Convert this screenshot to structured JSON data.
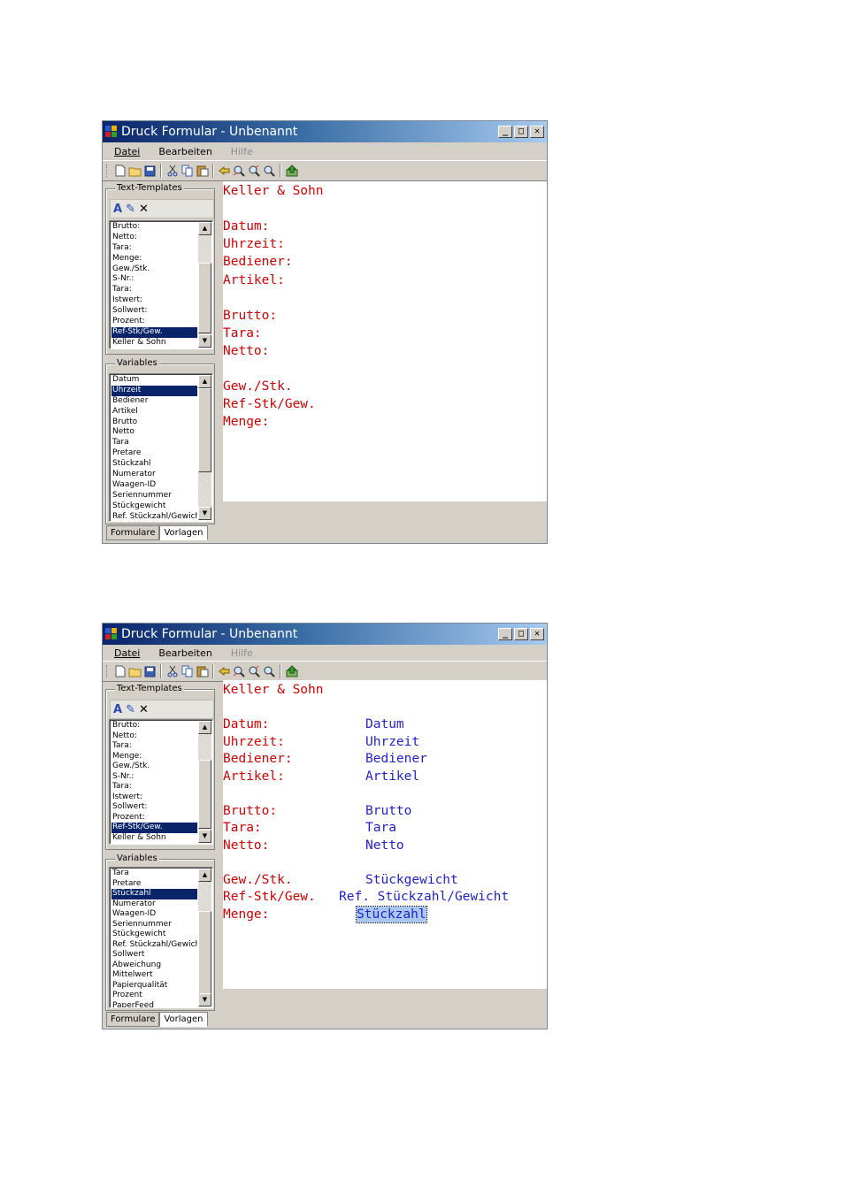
{
  "window_title": "Druck Formular - Unbenannt",
  "window_controls": {
    "minimize": "_",
    "maximize": "□",
    "close": "✕"
  },
  "menu": [
    {
      "label": "Datei",
      "disabled": false
    },
    {
      "label": "Bearbeiten",
      "disabled": false
    },
    {
      "label": "Hilfe",
      "disabled": true
    }
  ],
  "toolbar_icons": [
    "new-file-icon",
    "open-folder-icon",
    "save-icon",
    "cut-icon",
    "copy-icon",
    "paste-icon",
    "left-bracket-icon",
    "zoom-out-icon",
    "zoom-in-icon",
    "zoom-icon",
    "export-icon"
  ],
  "text_templates_label": "Text-Templates",
  "variables_label": "Variables",
  "tabs": {
    "formulare": "Formulare",
    "vorlagen": "Vorlagen"
  },
  "text_templates": [
    "Brutto:",
    "Netto:",
    "Tara:",
    "Menge:",
    "Gew./Stk.",
    "S-Nr.:",
    "Tara:",
    "Istwert:",
    "Sollwert:",
    "Prozent:",
    "Ref-Stk/Gew.",
    "Keller & Sohn"
  ],
  "text_templates_selected": "Ref-Stk/Gew.",
  "screen1": {
    "variables": [
      "Datum",
      "Uhrzeit",
      "Bediener",
      "Artikel",
      "Brutto",
      "Netto",
      "Tara",
      "Pretare",
      "Stückzahl",
      "Numerator",
      "Waagen-ID",
      "Seriennummer",
      "Stückgewicht",
      "Ref. Stückzahl/Gewicht"
    ],
    "variables_selected": "Uhrzeit",
    "editor_lines": [
      {
        "label": "Keller & Sohn"
      },
      {
        "label": ""
      },
      {
        "label": "Datum:"
      },
      {
        "label": "Uhrzeit:"
      },
      {
        "label": "Bediener:"
      },
      {
        "label": "Artikel:"
      },
      {
        "label": ""
      },
      {
        "label": "Brutto:"
      },
      {
        "label": "Tara:"
      },
      {
        "label": "Netto:"
      },
      {
        "label": ""
      },
      {
        "label": "Gew./Stk."
      },
      {
        "label": "Ref-Stk/Gew."
      },
      {
        "label": "Menge:"
      }
    ]
  },
  "screen2": {
    "variables": [
      "Tara",
      "Pretare",
      "Stückzahl",
      "Numerator",
      "Waagen-ID",
      "Seriennummer",
      "Stückgewicht",
      "Ref. Stückzahl/Gewicht",
      "Sollwert",
      "Abweichung",
      "Mittelwert",
      "Papierqualität",
      "Prozent",
      "PaperFeed"
    ],
    "variables_selected": "Stückzahl",
    "editor_lines": [
      {
        "label": "Keller & Sohn",
        "value": ""
      },
      {
        "label": "",
        "value": ""
      },
      {
        "label": "Datum:",
        "value": "Datum"
      },
      {
        "label": "Uhrzeit:",
        "value": "Uhrzeit"
      },
      {
        "label": "Bediener:",
        "value": "Bediener"
      },
      {
        "label": "Artikel:",
        "value": "Artikel"
      },
      {
        "label": "",
        "value": ""
      },
      {
        "label": "Brutto:",
        "value": "Brutto"
      },
      {
        "label": "Tara:",
        "value": "Tara"
      },
      {
        "label": "Netto:",
        "value": "Netto"
      },
      {
        "label": "",
        "value": ""
      },
      {
        "label": "Gew./Stk.",
        "value": "Stückgewicht"
      },
      {
        "label": "Ref-Stk/Gew.",
        "value": "Ref. Stückzahl/Gewicht"
      },
      {
        "label": "Menge:",
        "value": "Stückzahl",
        "selected": true
      }
    ]
  }
}
